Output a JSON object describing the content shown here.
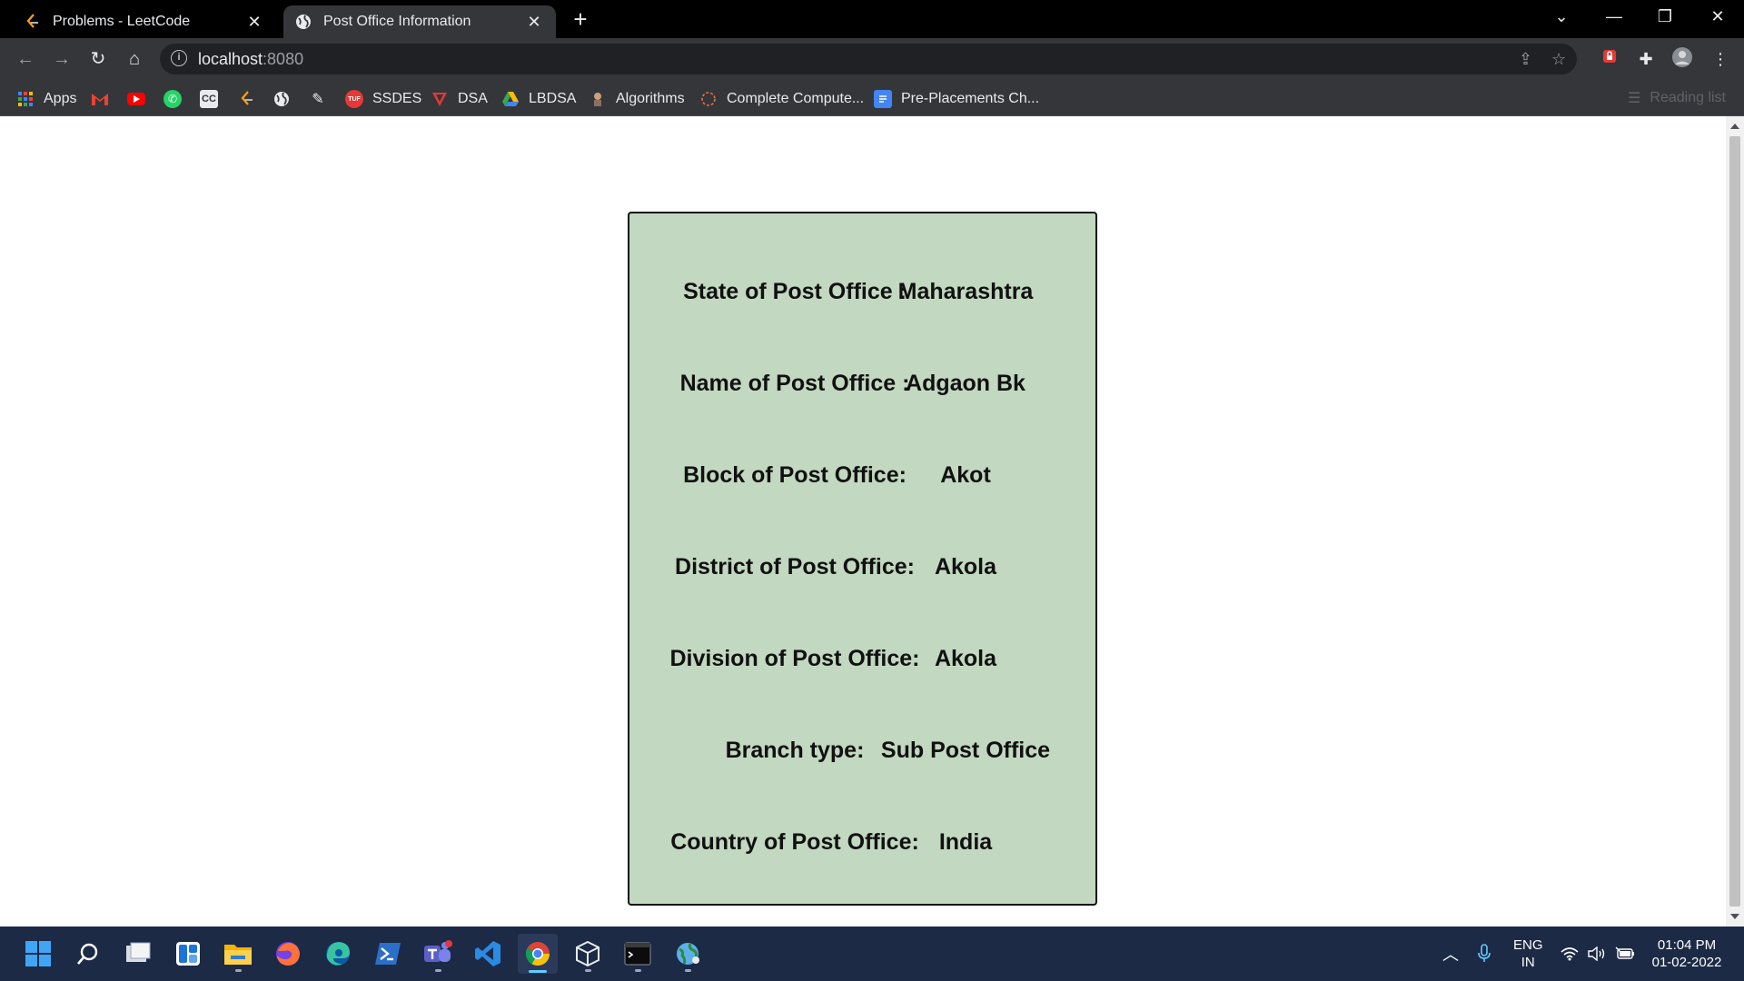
{
  "browser": {
    "tabs": [
      {
        "title": "Problems - LeetCode",
        "icon": "leetcode-icon",
        "active": false
      },
      {
        "title": "Post Office Information",
        "icon": "globe-icon",
        "active": true
      }
    ],
    "url_host": "localhost",
    "url_port": ":8080",
    "bookmarks": [
      {
        "label": "Apps",
        "icon": "apps-grid-icon"
      },
      {
        "label": "",
        "icon": "gmail-icon"
      },
      {
        "label": "",
        "icon": "youtube-icon"
      },
      {
        "label": "",
        "icon": "whatsapp-icon"
      },
      {
        "label": "",
        "icon": "cc-icon"
      },
      {
        "label": "",
        "icon": "leetcode-icon"
      },
      {
        "label": "",
        "icon": "globe-icon"
      },
      {
        "label": "",
        "icon": "feather-icon"
      },
      {
        "label": "SSDES",
        "icon": "tuf-icon"
      },
      {
        "label": "DSA",
        "icon": "dsa-icon"
      },
      {
        "label": "LBDSA",
        "icon": "drive-icon"
      },
      {
        "label": "Algorithms",
        "icon": "algorithms-icon"
      },
      {
        "label": "Complete Compute...",
        "icon": "loading-icon"
      },
      {
        "label": "Pre-Placements Ch...",
        "icon": "docs-icon"
      }
    ],
    "reading_list": "Reading list"
  },
  "post_office": {
    "rows": [
      {
        "label": "State of Post Office :",
        "value": "Maharashtra"
      },
      {
        "label": "Name of Post Office :",
        "value": "Adgaon Bk"
      },
      {
        "label": "Block of Post Office:",
        "value": "Akot"
      },
      {
        "label": "District of Post Office:",
        "value": "Akola"
      },
      {
        "label": "Division of Post Office:",
        "value": "Akola"
      },
      {
        "label": "Branch type:",
        "value": "Sub Post Office"
      },
      {
        "label": "Country of Post Office:",
        "value": "India"
      }
    ],
    "card_color": "#c2d8c0"
  },
  "taskbar": {
    "language": "ENG",
    "region": "IN",
    "time": "01:04 PM",
    "date": "01-02-2022"
  }
}
